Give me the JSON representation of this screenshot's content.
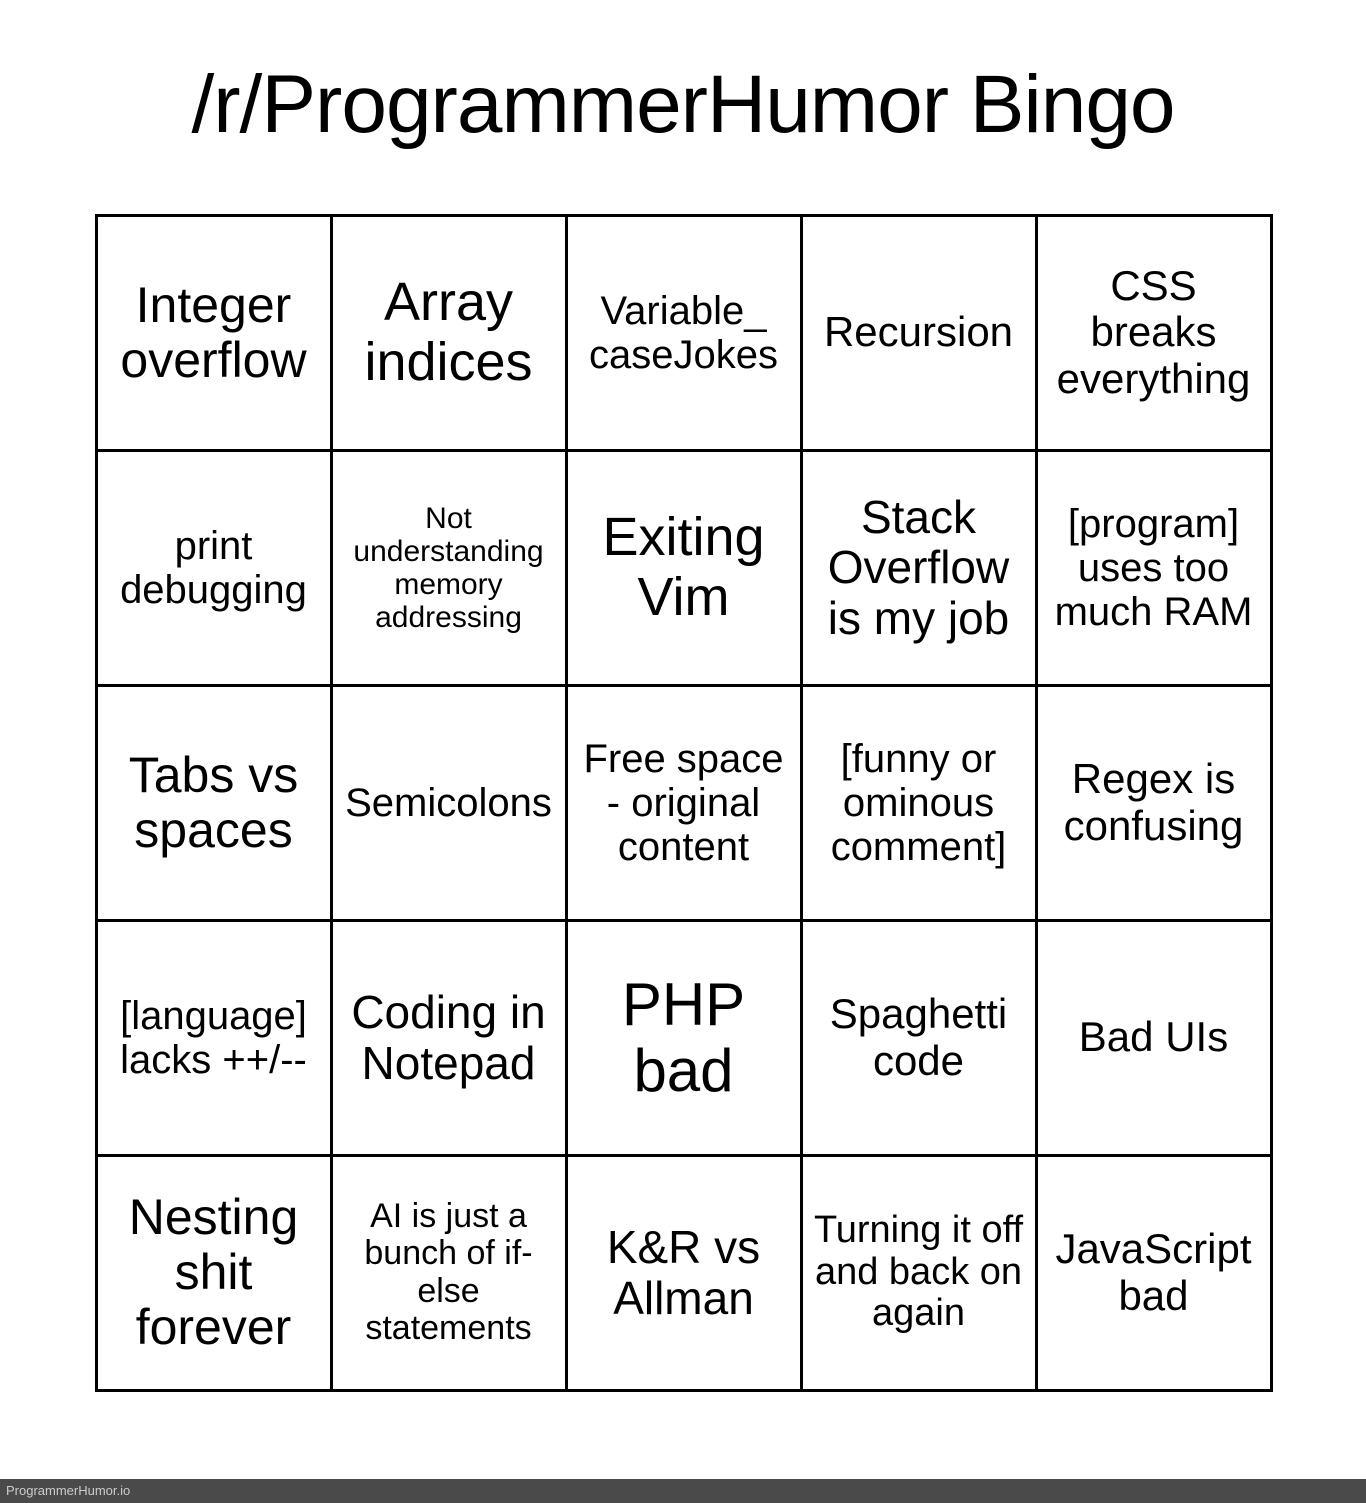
{
  "title": "/r/ProgrammerHumor Bingo",
  "watermark": "ProgrammerHumor.io",
  "cells": [
    [
      {
        "text": "Integer overflow",
        "size": "fs-50"
      },
      {
        "text": "Array indices",
        "size": "fs-54"
      },
      {
        "text": "Variable_\ncaseJokes",
        "size": "fs-40"
      },
      {
        "text": "Recursion",
        "size": "fs-42"
      },
      {
        "text": "CSS breaks everything",
        "size": "fs-42"
      }
    ],
    [
      {
        "text": "print debugging",
        "size": "fs-40"
      },
      {
        "text": "Not understanding memory addressing",
        "size": "fs-30"
      },
      {
        "text": "Exiting Vim",
        "size": "fs-54"
      },
      {
        "text": "Stack Overflow is my job",
        "size": "fs-46"
      },
      {
        "text": "[program] uses too much RAM",
        "size": "fs-40"
      }
    ],
    [
      {
        "text": "Tabs vs spaces",
        "size": "fs-50"
      },
      {
        "text": "Semicolons",
        "size": "fs-40"
      },
      {
        "text": "Free space - original content",
        "size": "fs-40"
      },
      {
        "text": "[funny or ominous comment]",
        "size": "fs-40"
      },
      {
        "text": "Regex is confusing",
        "size": "fs-42"
      }
    ],
    [
      {
        "text": "[language] lacks ++/--",
        "size": "fs-40"
      },
      {
        "text": "Coding in Notepad",
        "size": "fs-46"
      },
      {
        "text": "PHP bad",
        "size": "fs-60"
      },
      {
        "text": "Spaghetti code",
        "size": "fs-42"
      },
      {
        "text": "Bad UIs",
        "size": "fs-42"
      }
    ],
    [
      {
        "text": "Nesting shit forever",
        "size": "fs-50"
      },
      {
        "text": "AI is just a bunch of if-else statements",
        "size": "fs-34"
      },
      {
        "text": "K&R vs Allman",
        "size": "fs-46"
      },
      {
        "text": "Turning it off and back on again",
        "size": "fs-38"
      },
      {
        "text": "JavaScript bad",
        "size": "fs-42"
      }
    ]
  ]
}
